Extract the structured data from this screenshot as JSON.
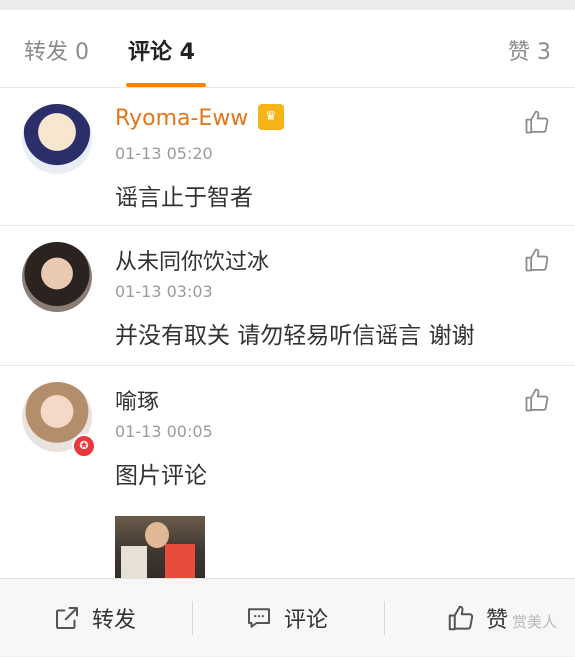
{
  "tabs": [
    {
      "label": "转发 0"
    },
    {
      "label": "评论 4"
    },
    {
      "label": "赞 3"
    }
  ],
  "comments": [
    {
      "name": "Ryoma-Eww",
      "time": "01-13 05:20",
      "text": "谣言止于智者"
    },
    {
      "name": "从未同你饮过冰",
      "time": "01-13 03:03",
      "text": "并没有取关 请勿轻易听信谣言 谢谢"
    },
    {
      "name": "喻琢",
      "time": "01-13 00:05",
      "text": "图片评论"
    }
  ],
  "bottom_bar": {
    "repost": "转发",
    "comment": "评论",
    "like": "赞"
  },
  "watermark": "赏美人",
  "colors": {
    "accent": "#ff8200",
    "vip_name": "#e2761b",
    "badge_red": "#e8383d"
  }
}
